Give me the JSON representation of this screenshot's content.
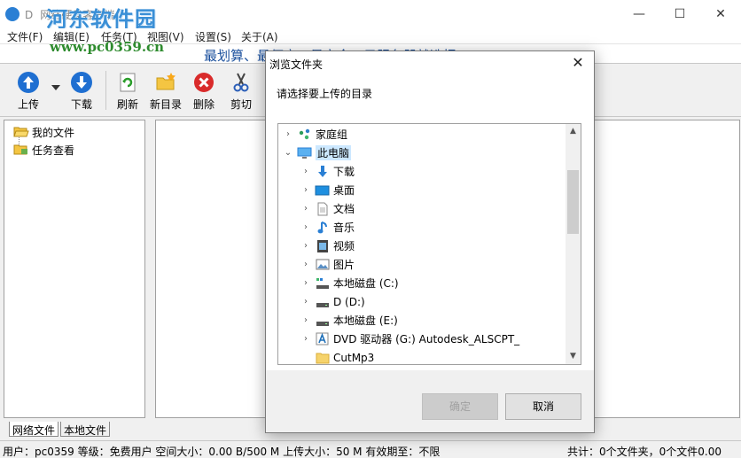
{
  "window": {
    "title": "D",
    "title_fragment": "网络硬盘客户端",
    "watermark": "河东软件园",
    "watermark_url": "www.pc0359.cn",
    "controls": {
      "minimize": "—",
      "maximize": "☐",
      "close": "✕"
    }
  },
  "menu": {
    "items": [
      "文件(F)",
      "编辑(E)",
      "任务(T)",
      "视图(V)",
      "设置(S)",
      "关于(A)"
    ]
  },
  "banner": {
    "text": "最划算、最便宜、最安全、云服务器就选择..."
  },
  "toolbar": {
    "upload": "上传",
    "download": "下载",
    "refresh": "刷新",
    "new_folder": "新目录",
    "delete": "删除",
    "cut": "剪切"
  },
  "tree": {
    "items": [
      {
        "label": "我的文件"
      },
      {
        "label": "任务查看"
      }
    ]
  },
  "tabs": [
    "网络文件",
    "本地文件"
  ],
  "status": {
    "left": "用户：pc0359   等级：免费用户   空间大小：0.00 B/500 M   上传大小：50 M   有效期至：不限",
    "right": "共计：0个文件夹，0个文件0.00"
  },
  "dialog": {
    "title": "浏览文件夹",
    "close": "✕",
    "instruction": "请选择要上传的目录",
    "items": [
      {
        "label": "家庭组",
        "arrow": "›",
        "icon": "homegroup-icon"
      },
      {
        "label": "此电脑",
        "arrow": "⌄",
        "icon": "computer-icon"
      },
      {
        "label": "下载",
        "arrow": "›",
        "icon": "download-folder-icon"
      },
      {
        "label": "桌面",
        "arrow": "›",
        "icon": "desktop-folder-icon"
      },
      {
        "label": "文档",
        "arrow": "›",
        "icon": "documents-folder-icon"
      },
      {
        "label": "音乐",
        "arrow": "›",
        "icon": "music-folder-icon"
      },
      {
        "label": "视频",
        "arrow": "›",
        "icon": "videos-folder-icon"
      },
      {
        "label": "图片",
        "arrow": "›",
        "icon": "pictures-folder-icon"
      },
      {
        "label": "本地磁盘 (C:)",
        "arrow": "›",
        "icon": "system-drive-icon"
      },
      {
        "label": "D (D:)",
        "arrow": "›",
        "icon": "drive-icon"
      },
      {
        "label": "本地磁盘 (E:)",
        "arrow": "›",
        "icon": "drive-icon"
      },
      {
        "label": "DVD 驱动器 (G:) Autodesk_ALSCPT_",
        "arrow": "›",
        "icon": "dvd-drive-icon"
      },
      {
        "label": "CutMp3",
        "arrow": "",
        "icon": "folder-icon"
      }
    ],
    "ok": "确定",
    "cancel": "取消"
  },
  "colors": {
    "accent_blue": "#2a7fd4",
    "selection": "#cce8ff",
    "banner_text": "#1a4f9c",
    "watermark_blue": "#3a8fd6",
    "watermark_green": "#2e8b2e"
  }
}
